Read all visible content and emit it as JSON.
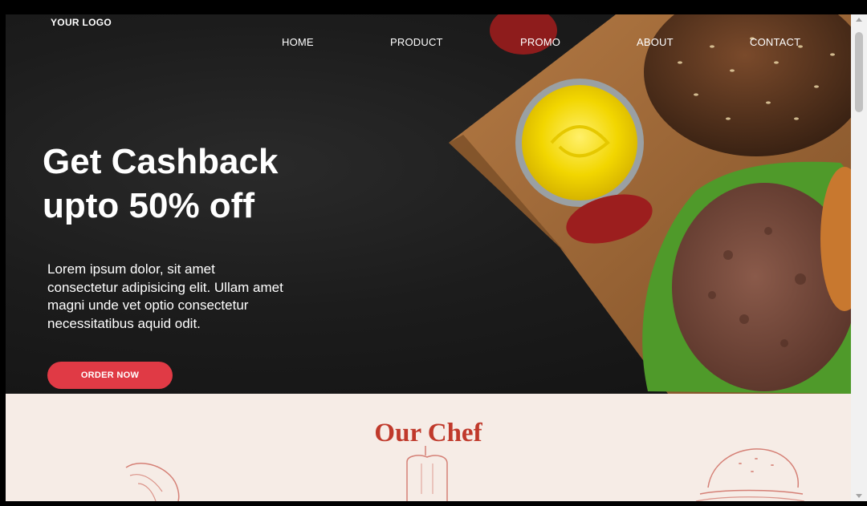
{
  "header": {
    "logo": "YOUR LOGO",
    "nav": [
      "HOME",
      "PRODUCT",
      "PROMO",
      "ABOUT",
      "CONTACT"
    ]
  },
  "hero": {
    "headline_line1": "Get Cashback",
    "headline_line2": "upto 50% off",
    "description": "Lorem ipsum dolor, sit amet consectetur adipisicing elit. Ullam amet magni unde vet optio consectetur necessitatibus aquid odit.",
    "cta_label": "ORDER NOW"
  },
  "chef_section": {
    "title": "Our Chef"
  },
  "colors": {
    "accent": "#e03a45",
    "title_red": "#c0392b",
    "hero_bg": "#1c1c1c",
    "section_bg": "#f6ece6"
  },
  "icons": [
    "croissant-sketch-icon",
    "pepper-sketch-icon",
    "burger-sketch-icon"
  ]
}
